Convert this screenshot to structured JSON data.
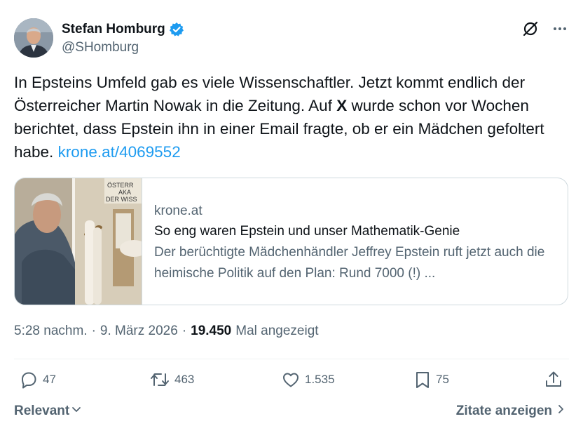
{
  "author": {
    "name": "Stefan Homburg",
    "handle": "@SHomburg"
  },
  "icons": {
    "verified": "verified-badge-icon",
    "grok": "grok-icon",
    "more": "more-icon",
    "reply": "reply-icon",
    "retweet": "retweet-icon",
    "like": "like-icon",
    "bookmark": "bookmark-icon",
    "share": "share-icon"
  },
  "tweet": {
    "text_part1": "In Epsteins Umfeld gab es viele Wissenschaftler. Jetzt kommt endlich der Österreicher Martin Nowak in die Zeitung. Auf ",
    "text_bold": "X",
    "text_part2": " wurde schon vor Wochen berichtet, dass Epstein ihn in einer Email fragte, ob er ein Mädchen gefoltert habe. ",
    "link": "krone.at/4069552"
  },
  "card": {
    "domain": "krone.at",
    "title": "So eng waren Epstein und unser Mathematik-Genie",
    "description": "Der berüchtigte Mädchenhändler Jeffrey Epstein ruft jetzt auch die heimische Politik auf den Plan: Rund 7000 (!) ...",
    "thumb_sign_line1": "ÖSTERR",
    "thumb_sign_line2": "AKA",
    "thumb_sign_line3": "DER WISS"
  },
  "meta": {
    "time": "5:28 nachm.",
    "sep1": "·",
    "date": "9. März 2026",
    "sep2": "·",
    "views_count": "19.450",
    "views_label": "Mal angezeigt"
  },
  "actions": {
    "replies": "47",
    "reposts": "463",
    "likes": "1.535",
    "bookmarks": "75"
  },
  "footer": {
    "sort_label": "Relevant",
    "quotes_label": "Zitate anzeigen"
  },
  "colors": {
    "text": "#0f1419",
    "secondary": "#536471",
    "link": "#1d9bf0",
    "border": "#cfd9de"
  }
}
